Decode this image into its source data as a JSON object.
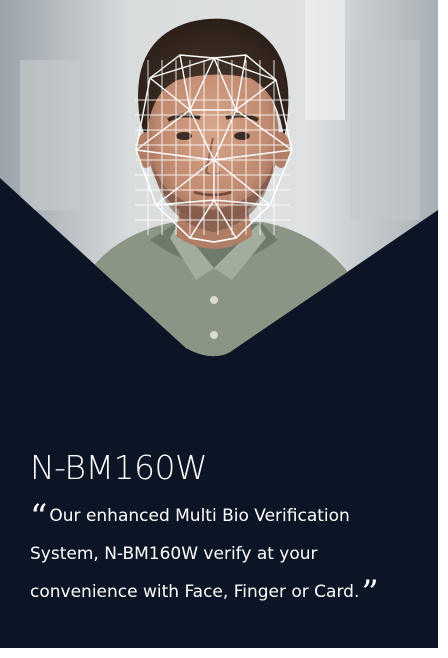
{
  "product": {
    "model": "N-BM160W",
    "open_quote": "“",
    "close_quote": "”",
    "tagline_line1": "Our enhanced Multi Bio Verification",
    "tagline_line2": "System, N-BM160W verify at your",
    "tagline_line3": "convenience with Face, Finger or Card."
  },
  "colors": {
    "background": "#0c1526",
    "text": "#ffffff",
    "mesh": "#ffffff"
  },
  "icons": {
    "photo": "man-portrait-with-face-recognition-mesh"
  }
}
